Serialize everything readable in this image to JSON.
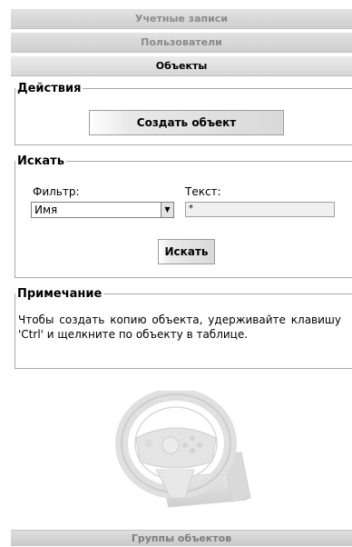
{
  "tabs": [
    {
      "label": "Учетные записи"
    },
    {
      "label": "Пользователи"
    },
    {
      "label": "Объекты"
    }
  ],
  "actions": {
    "legend": "Действия",
    "create_label": "Создать объект"
  },
  "search": {
    "legend": "Искать",
    "filter_label": "Фильтр:",
    "filter_value": "Имя",
    "text_label": "Текст:",
    "text_value": "*",
    "search_label": "Искать"
  },
  "note": {
    "legend": "Примечание",
    "text": "Чтобы создать копию объекта, удерживайте клавишу 'Ctrl' и щелкните по объекту в таблице."
  },
  "bottom_tab": {
    "label": "Группы объектов"
  },
  "icons": {
    "illustration": "steering-wheel-icon",
    "dropdown": "chevron-down-icon"
  },
  "colors": {
    "active_tab_bg": "#dcdcdc",
    "inactive_tab_text": "#8a8a8a",
    "fieldset_border": "#a9a9a9"
  }
}
